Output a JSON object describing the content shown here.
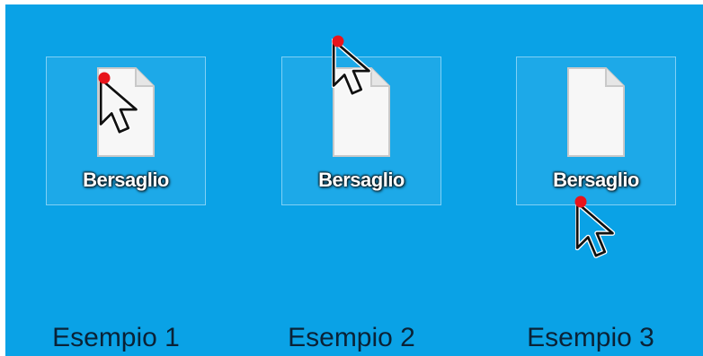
{
  "examples": [
    {
      "file_label": "Bersaglio",
      "caption": "Esempio 1",
      "hotspot": "top-left-of-icon"
    },
    {
      "file_label": "Bersaglio",
      "caption": "Esempio 2",
      "hotspot": "above-icon"
    },
    {
      "file_label": "Bersaglio",
      "caption": "Esempio 3",
      "hotspot": "bottom-of-label"
    }
  ],
  "colors": {
    "background": "#0aa2e6",
    "hotspot_dot": "#e8141b",
    "caption_text": "#0a2236"
  },
  "icons": {
    "file": "document-icon",
    "pointer": "arrow-cursor-icon"
  }
}
